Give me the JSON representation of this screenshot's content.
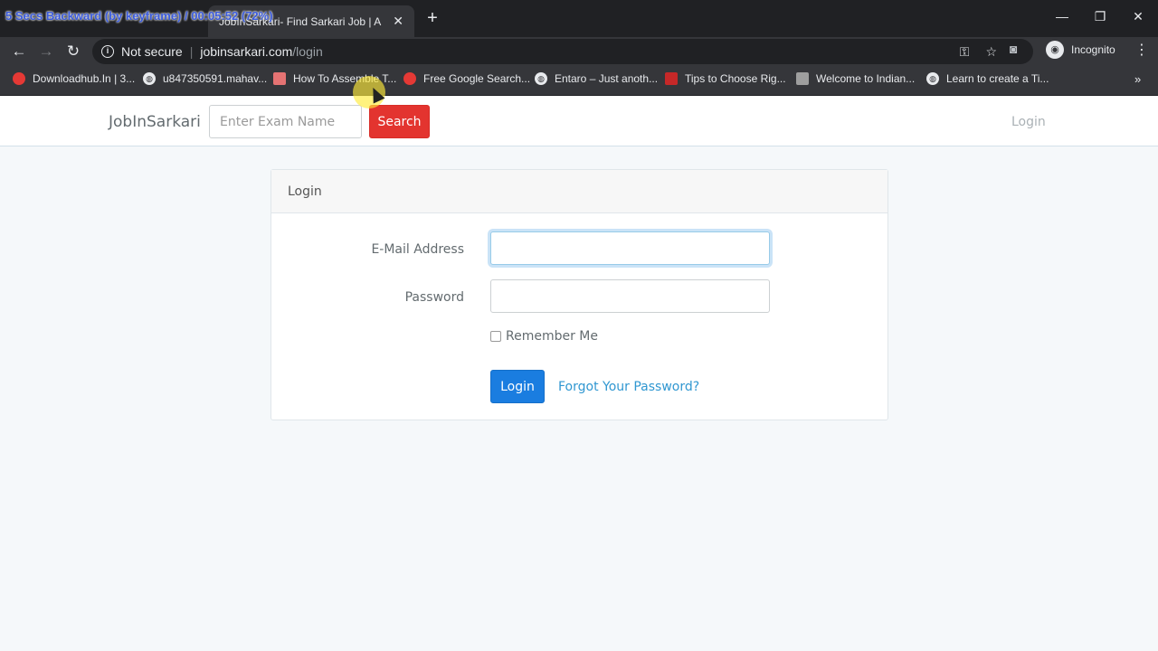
{
  "overlay": {
    "text": "5 Secs Backward (by keyframe) / 00:05:52 (72%)"
  },
  "tabs": [
    {
      "title": "",
      "state": "inactive"
    },
    {
      "title": "JobInSarkari- Find Sarkari Job | A",
      "state": "active"
    }
  ],
  "toolbar": {
    "security_label": "Not secure",
    "url_host": "jobinsarkari.com",
    "url_path": "/login",
    "profile_label": "Incognito"
  },
  "bookmarks": [
    {
      "label": "Downloadhub.In | 3...",
      "icon": "red-circle-icon",
      "color": "#e53935"
    },
    {
      "label": "u847350591.mahav...",
      "icon": "globe-icon",
      "color": "#e8eaed"
    },
    {
      "label": "How To Assemble T...",
      "icon": "site-icon",
      "color": "#e57373"
    },
    {
      "label": "Free Google Search...",
      "icon": "site-icon",
      "color": "#e53935"
    },
    {
      "label": "Entaro – Just anoth...",
      "icon": "globe-icon",
      "color": "#e8eaed"
    },
    {
      "label": "Tips to Choose Rig...",
      "icon": "site-icon",
      "color": "#c62828"
    },
    {
      "label": "Welcome to Indian...",
      "icon": "site-icon",
      "color": "#9e9e9e"
    },
    {
      "label": "Learn to create a Ti...",
      "icon": "globe-icon",
      "color": "#e8eaed"
    }
  ],
  "navbar": {
    "brand": "JobInSarkari",
    "search_placeholder": "Enter Exam Name",
    "search_button": "Search",
    "login_link": "Login"
  },
  "login_panel": {
    "heading": "Login",
    "email_label": "E-Mail Address",
    "password_label": "Password",
    "remember_label": "Remember Me",
    "login_button": "Login",
    "forgot_link": "Forgot Your Password?"
  },
  "colors": {
    "search_button": "#e3342f",
    "login_button": "#1a7de0",
    "link": "#3097d1"
  }
}
